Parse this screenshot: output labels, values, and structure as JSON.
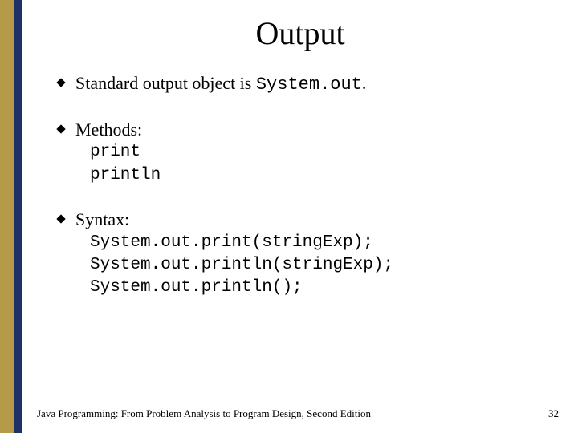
{
  "title": "Output",
  "bullets": [
    {
      "text_prefix": "Standard output object is ",
      "code": "System.out",
      "text_suffix": "."
    },
    {
      "text_prefix": "Methods:",
      "sublines": [
        "print",
        "println"
      ]
    },
    {
      "text_prefix": "Syntax:",
      "sublines": [
        "System.out.print(stringExp);",
        "System.out.println(stringExp);",
        "System.out.println();"
      ]
    }
  ],
  "footer": "Java Programming: From Problem Analysis to Program Design, Second Edition",
  "page_number": "32"
}
